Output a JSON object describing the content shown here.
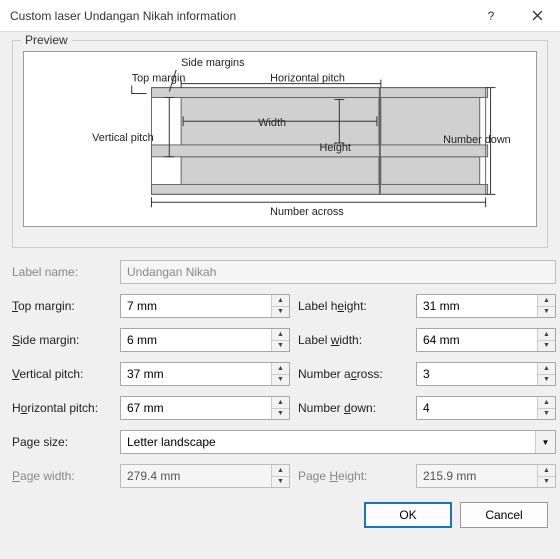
{
  "title": "Custom laser Undangan Nikah information",
  "preview_legend": "Preview",
  "preview_labels": {
    "side_margins": "Side margins",
    "top_margin": "Top margin",
    "horizontal_pitch": "Horizontal pitch",
    "vertical_pitch": "Vertical pitch",
    "width": "Width",
    "height": "Height",
    "number_down": "Number down",
    "number_across": "Number across"
  },
  "fields": {
    "label_name": {
      "label": "Label name:",
      "value": "Undangan Nikah"
    },
    "top_margin": {
      "label": "Top margin:",
      "value": "7 mm"
    },
    "side_margin": {
      "label": "Side margin:",
      "value": "6 mm"
    },
    "vertical_pitch": {
      "label": "Vertical pitch:",
      "value": "37 mm"
    },
    "horizontal_pitch": {
      "label": "Horizontal pitch:",
      "value": "67 mm"
    },
    "label_height": {
      "label": "Label height:",
      "value": "31 mm"
    },
    "label_width": {
      "label": "Label width:",
      "value": "64 mm"
    },
    "number_across": {
      "label": "Number across:",
      "value": "3"
    },
    "number_down": {
      "label": "Number down:",
      "value": "4"
    },
    "page_size": {
      "label": "Page size:",
      "value": "Letter landscape"
    },
    "page_width": {
      "label": "Page width:",
      "value": "279.4 mm"
    },
    "page_height": {
      "label": "Page Height:",
      "value": "215.9 mm"
    }
  },
  "buttons": {
    "ok": "OK",
    "cancel": "Cancel"
  }
}
